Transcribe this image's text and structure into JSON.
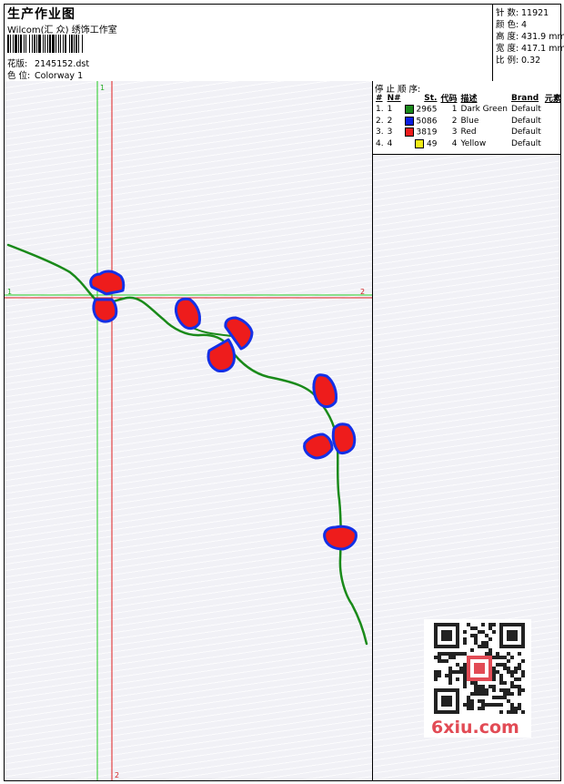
{
  "header": {
    "title": "生产作业图",
    "subtitle": "Wilcom(汇 众) 绣饰工作室",
    "design_label": "花版:",
    "design_value": "2145152.dst",
    "colorway_label": "色 位:",
    "colorway_value": "Colorway 1"
  },
  "stats": [
    {
      "label": "针 数:",
      "value": "11921"
    },
    {
      "label": "颜 色:",
      "value": "4"
    },
    {
      "label": "高 度:",
      "value": "431.9 mm"
    },
    {
      "label": "宽 度:",
      "value": "417.1 mm"
    },
    {
      "label": "比 例:",
      "value": "0.32"
    }
  ],
  "stop_sequence": {
    "title": "停 止 顺 序:",
    "columns": [
      "#",
      "N#",
      "St.",
      "代码",
      "描述",
      "Brand",
      "元素"
    ],
    "rows": [
      {
        "num": "1.",
        "n": "1",
        "color": "#1a8a1a",
        "stitches": "2965",
        "code": "1",
        "desc": "Dark Green",
        "brand": "Default"
      },
      {
        "num": "2.",
        "n": "2",
        "color": "#0a1ee0",
        "stitches": "5086",
        "code": "2",
        "desc": "Blue",
        "brand": "Default"
      },
      {
        "num": "3.",
        "n": "3",
        "color": "#ee1c1c",
        "stitches": "3819",
        "code": "3",
        "desc": "Red",
        "brand": "Default"
      },
      {
        "num": "4.",
        "n": "4",
        "color": "#f2ec16",
        "stitches": "49",
        "code": "4",
        "desc": "Yellow",
        "brand": "Default"
      }
    ]
  },
  "guides": {
    "v1": "1",
    "v2": "2",
    "h1": "1",
    "h2": "2"
  },
  "colors": {
    "stem": "#1a8a1a",
    "outline": "#1430e6",
    "fill": "#ee1c1c",
    "guide_green": "#22cc22",
    "guide_red": "#e02020"
  },
  "watermark": "6xiu.com"
}
